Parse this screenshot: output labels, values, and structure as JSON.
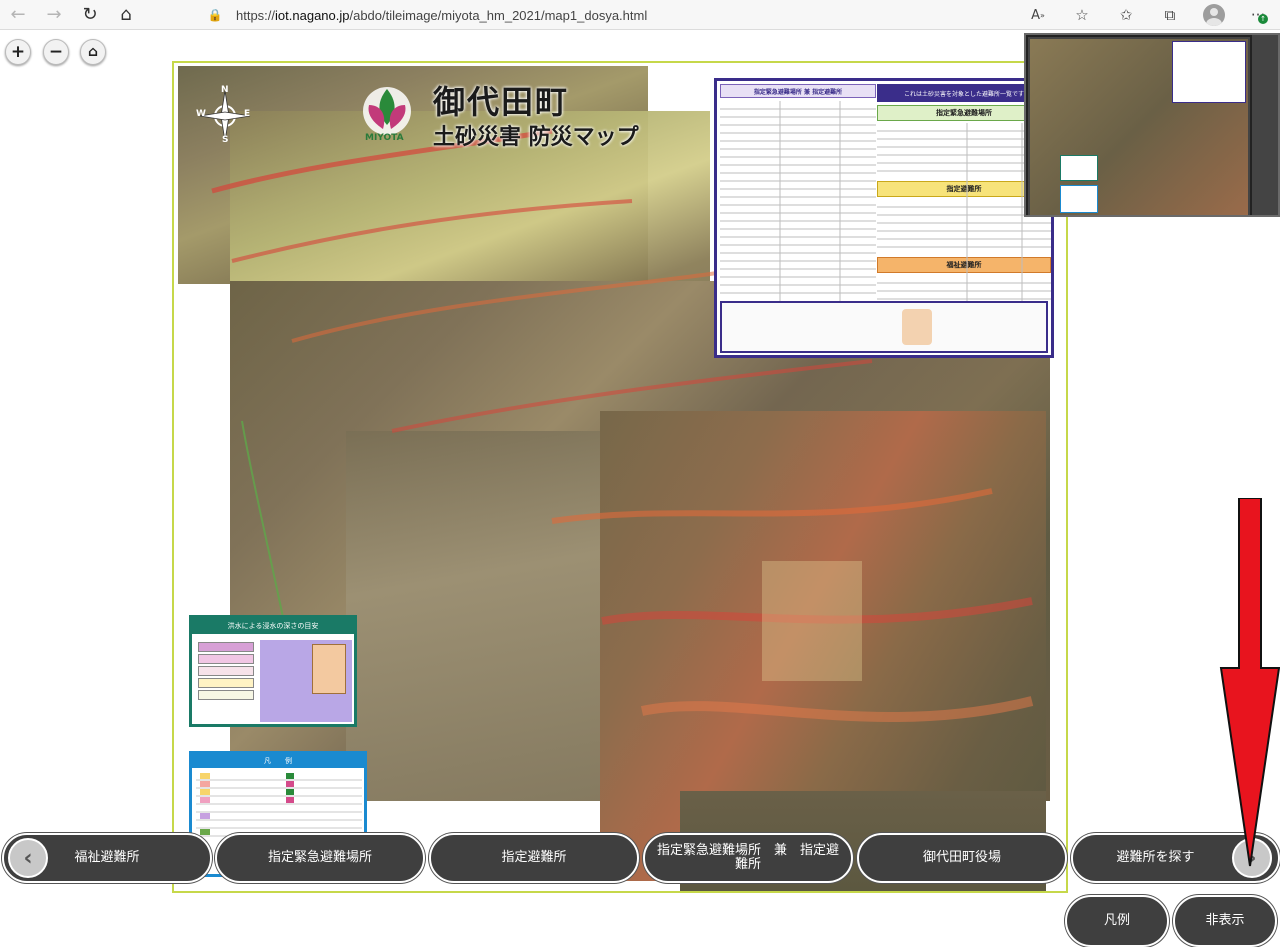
{
  "browser": {
    "url_prefix": "https://",
    "url_host": "iot.nagano.jp",
    "url_path": "/abdo/tileimage/miyota_hm_2021/map1_dosya.html"
  },
  "map_controls": {
    "zoom_in": "+",
    "zoom_out": "−",
    "home": "⌂"
  },
  "map": {
    "title_main": "御代田町",
    "title_sub": "土砂災害 防災マップ",
    "logo_text": "MIYOTA",
    "compass_n": "N",
    "compass_s": "S",
    "compass_e": "E",
    "compass_w": "W",
    "panel_header_left": "指定緊急避難場所 兼 指定避難所",
    "panel_header_right": "これは土砂災害を対象とした避難所一覧です",
    "panel_sub1": "指定緊急避難場所",
    "panel_sub2": "指定避難所",
    "panel_sub3": "福祉避難所",
    "flood_title": "洪水による浸水の深さの目安",
    "legend_title": "凡　　例"
  },
  "bottom_buttons": [
    {
      "label": "福祉避難所"
    },
    {
      "label": "指定緊急避難場所"
    },
    {
      "label": "指定避難所"
    },
    {
      "label": "指定緊急避難場所　兼　指定避難所"
    },
    {
      "label": "御代田町役場"
    },
    {
      "label": "避難所を探す"
    }
  ],
  "footer_buttons": {
    "legend": "凡例",
    "hide": "非表示"
  },
  "colors": {
    "button_bg": "#3f3f3f",
    "arrow_red": "#e8141e",
    "frame_green": "#c6d84a",
    "panel_purple": "#3a2d8a"
  }
}
